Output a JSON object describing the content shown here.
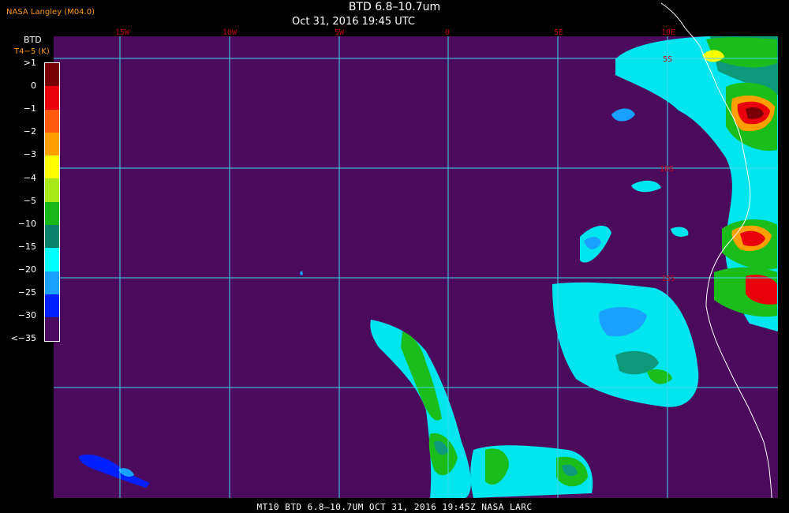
{
  "header": {
    "org": "NASA Langley (M04.0)",
    "title": "BTD 6.8–10.7um",
    "subtitle": "Oct 31, 2016 19:45 UTC"
  },
  "legend": {
    "title": "BTD",
    "units": "T4−5 (K)",
    "labels": [
      ">1",
      "0",
      "−1",
      "−2",
      "−3",
      "−4",
      "−5",
      "−10",
      "−15",
      "−20",
      "−25",
      "−30",
      "<−35"
    ],
    "colors": [
      "#7a0008",
      "#e8000a",
      "#ff5a10",
      "#ffa000",
      "#ffff00",
      "#a8e818",
      "#18b818",
      "#08806a",
      "#00ffff",
      "#1aa0ff",
      "#0020ff",
      "#4c0a60"
    ]
  },
  "map": {
    "background": "#4c0a5c",
    "grid_color": "#3dd9ef",
    "coast_color": "#ffffff",
    "lon_labels": [
      "15W",
      "10W",
      "5W",
      "0",
      "5E",
      "10E"
    ],
    "lat_labels": [
      "5S",
      "10S",
      "15S"
    ]
  },
  "footer": {
    "text": "MT10  BTD 6.8–10.7UM  OCT 31, 2016 19:45Z  NASA LARC"
  }
}
